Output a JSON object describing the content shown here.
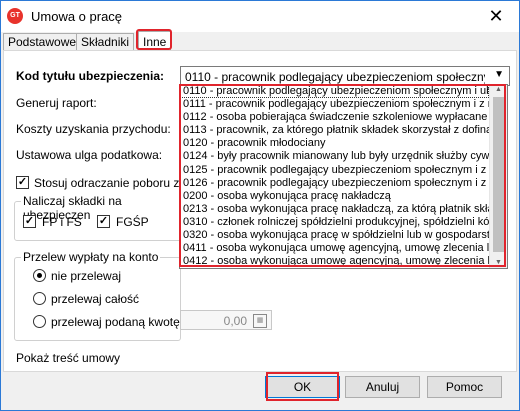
{
  "window": {
    "title": "Umowa o pracę",
    "app_icon": "GT",
    "close_glyph": "✕"
  },
  "tabs": [
    {
      "label": "Podstawowe"
    },
    {
      "label": "Składniki"
    },
    {
      "label": "Inne",
      "active": true
    }
  ],
  "form": {
    "kod_label": "Kod tytułu ubezpieczenia:",
    "kod_value": "0110 - pracownik podlegający ubezpieczeniom społecznym i ube",
    "generuj_label": "Generuj raport:",
    "koszty_label": "Koszty uzyskania przychodu:",
    "ulga_label": "Ustawowa ulga podatkowa:",
    "odraczanie_label": "Stosuj odraczanie poboru zali",
    "odraczanie_checked": true,
    "skladki_group_title": "Naliczaj składki na ubezpieczen",
    "fp_label": "FP i FS",
    "fp_checked": true,
    "fgsp_label": "FGŚP",
    "fgsp_checked": true,
    "przelew_group_title": "Przelew wypłaty na konto",
    "radio_nie": "nie przelewaj",
    "radio_calosc": "przelewaj całość",
    "radio_kwote": "przelewaj podaną kwotę",
    "selected_radio": "nie przelewaj",
    "kwota_value": "0,00",
    "pokaz_label": "Pokaż treść umowy"
  },
  "dropdown_items": [
    "0110 - pracownik podlegający ubezpieczeniom społecznym i ube",
    "0111 - pracownik podlegający ubezpieczeniom społecznym i z mo",
    "0112 - osoba pobierająca świadczenie szkoleniowe wypłacane po",
    "0113 - pracownik, za którego płatnik składek skorzystał z dofinan",
    "0120 - pracownik młodociany",
    "0124 - były pracownik mianowany lub były urzędnik służby cywilr",
    "0125 - pracownik podlegający ubezpieczeniom społecznym i z mo",
    "0126 - pracownik podlegający ubezpieczeniom społecznym i z mo",
    "0200 - osoba wykonująca pracę nakładczą",
    "0213 - osoba wykonująca pracę nakładczą, za którą płatnik składe",
    "0310 - członek rolniczej spółdzielni produkcyjnej, spółdzielni kółe",
    "0320 - osoba wykonująca pracę w spółdzielni lub w gospodarstw",
    "0411 - osoba wykonująca umowę agencyjną, umowę zlecenia lub",
    "0412 - osoba wykonująca umowę agencyjną, umowę zlecenia lub"
  ],
  "buttons": {
    "ok": "OK",
    "anuluj": "Anuluj",
    "pomoc": "Pomoc"
  },
  "colors": {
    "accent": "#0078d7",
    "highlight": "#e0242c"
  }
}
